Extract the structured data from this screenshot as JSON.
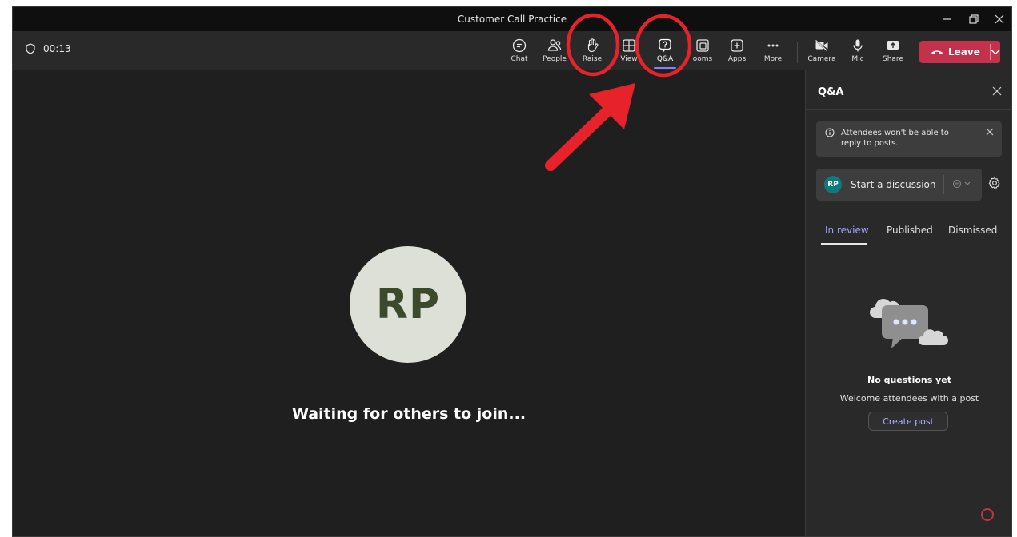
{
  "window": {
    "title": "Customer Call Practice"
  },
  "toolbar": {
    "timer": "00:13",
    "buttons": [
      {
        "label": "Chat"
      },
      {
        "label": "People"
      },
      {
        "label": "Raise"
      },
      {
        "label": "View"
      },
      {
        "label": "Q&A"
      },
      {
        "label": "ooms"
      },
      {
        "label": "Apps"
      },
      {
        "label": "More"
      },
      {
        "label": "Camera"
      },
      {
        "label": "Mic"
      },
      {
        "label": "Share"
      }
    ],
    "leave_label": "Leave",
    "active": "Q&A"
  },
  "stage": {
    "initials": "RP",
    "waiting_text": "Waiting for others to join..."
  },
  "panel": {
    "title": "Q&A",
    "notice": "Attendees won't be able to reply to posts.",
    "discussion": {
      "initials": "RP",
      "placeholder": "Start a discussion"
    },
    "tabs": [
      {
        "label": "In review",
        "selected": true
      },
      {
        "label": "Published",
        "selected": false
      },
      {
        "label": "Dismissed",
        "selected": false
      }
    ],
    "empty": {
      "title": "No questions yet",
      "subtitle": "Welcome attendees with a post",
      "button": "Create post"
    }
  },
  "colors": {
    "leave": "#c4314b",
    "accent": "#7f85f5",
    "annotation": "#e8222b"
  }
}
